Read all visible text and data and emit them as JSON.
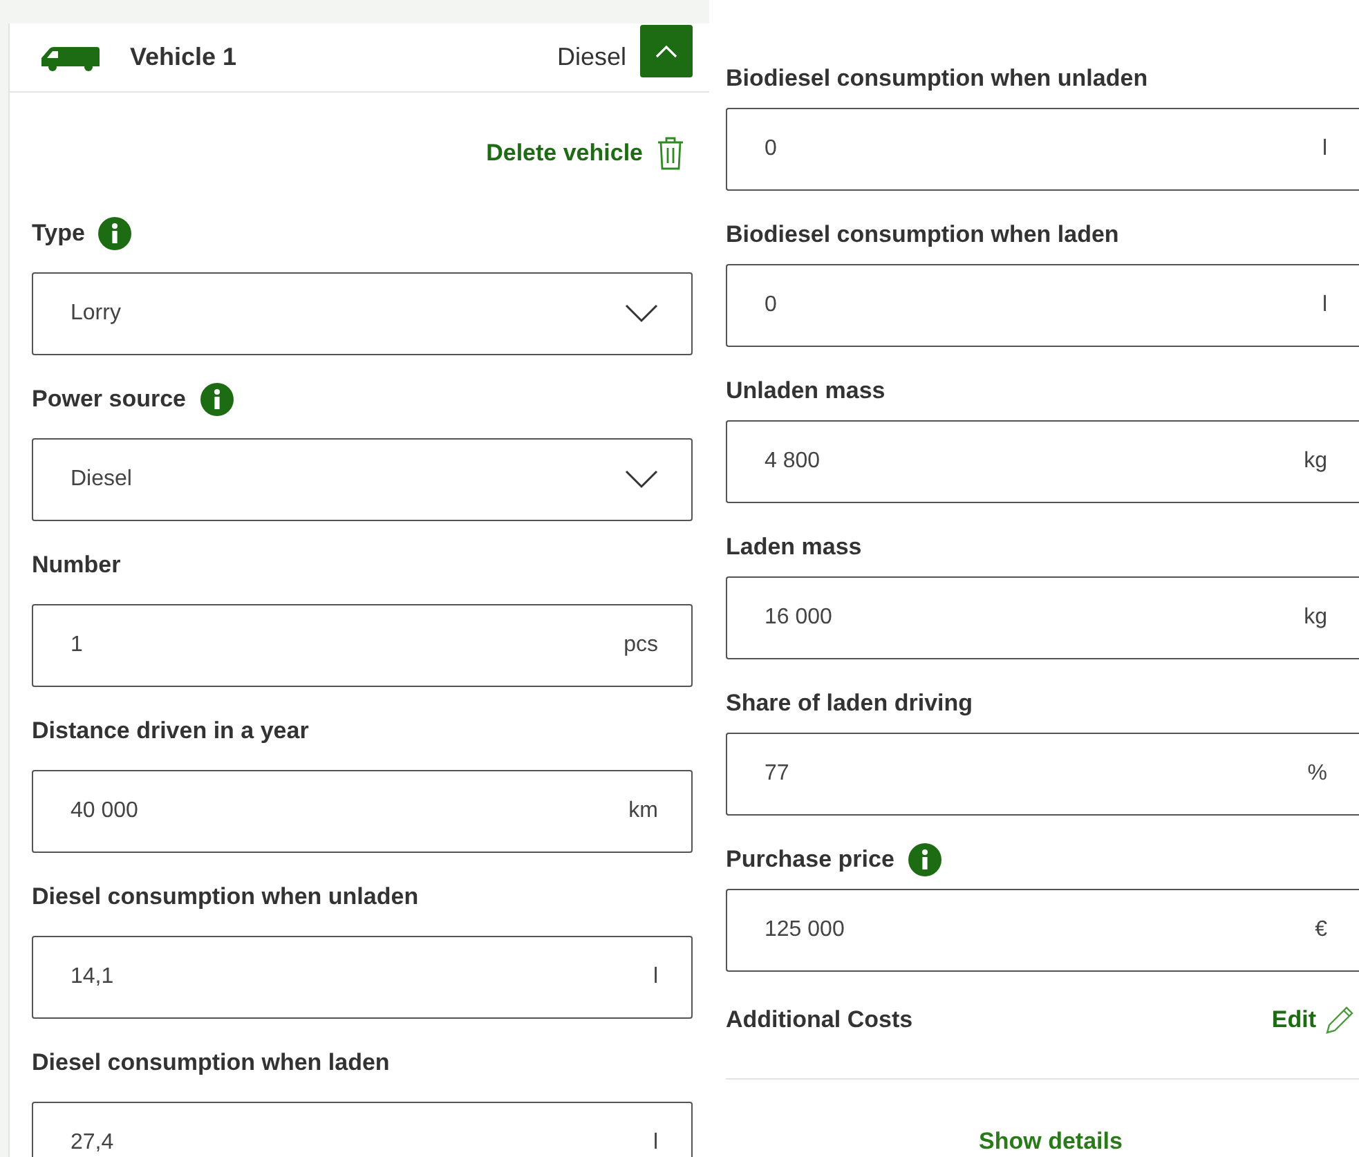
{
  "vehicle": {
    "title": "Vehicle 1",
    "power_summary": "Diesel",
    "expanded": true
  },
  "delete_label": "Delete vehicle",
  "left_fields": [
    {
      "kind": "select",
      "label": "Type",
      "info": true,
      "value": "Lorry"
    },
    {
      "kind": "select",
      "label": "Power source",
      "info": true,
      "value": "Diesel"
    },
    {
      "kind": "input",
      "label": "Number",
      "info": false,
      "value": "1",
      "unit": "pcs"
    },
    {
      "kind": "input",
      "label": "Distance driven in a year",
      "info": false,
      "value": "40 000",
      "unit": "km"
    },
    {
      "kind": "input",
      "label": "Diesel consumption when unladen",
      "info": false,
      "value": "14,1",
      "unit": "l"
    },
    {
      "kind": "input",
      "label": "Diesel consumption when laden",
      "info": false,
      "value": "27,4",
      "unit": "l"
    }
  ],
  "right_fields": [
    {
      "kind": "input",
      "label": "Biodiesel consumption when unladen",
      "info": false,
      "value": "0",
      "unit": "l"
    },
    {
      "kind": "input",
      "label": "Biodiesel consumption when laden",
      "info": false,
      "value": "0",
      "unit": "l"
    },
    {
      "kind": "input",
      "label": "Unladen mass",
      "info": false,
      "value": "4 800",
      "unit": "kg"
    },
    {
      "kind": "input",
      "label": "Laden mass",
      "info": false,
      "value": "16 000",
      "unit": "kg"
    },
    {
      "kind": "input",
      "label": "Share of laden driving",
      "info": false,
      "value": "77",
      "unit": "%"
    },
    {
      "kind": "input",
      "label": "Purchase price",
      "info": true,
      "value": "125 000",
      "unit": "€"
    }
  ],
  "additional_costs": {
    "label": "Additional Costs",
    "edit": "Edit"
  },
  "show_details": "Show details"
}
